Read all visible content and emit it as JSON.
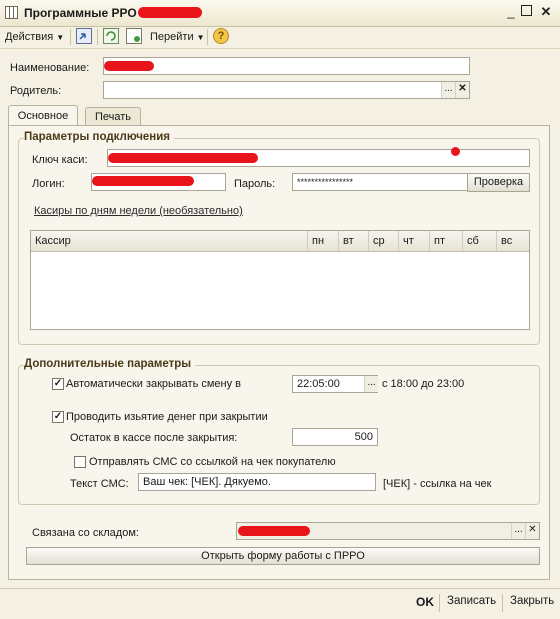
{
  "window": {
    "title": "Программные РРО"
  },
  "toolbar": {
    "actions_label": "Действия",
    "goto_label": "Перейти",
    "help_glyph": "?"
  },
  "form": {
    "name_label": "Наименование:",
    "parent_label": "Родитель:"
  },
  "tabs": [
    {
      "label": "Основное",
      "active": true
    },
    {
      "label": "Печать",
      "active": false
    }
  ],
  "connection": {
    "title": "Параметры подключения",
    "key_label": "Ключ каси:",
    "login_label": "Логин:",
    "password_label": "Пароль:",
    "password_value": "****************",
    "check_button": "Проверка",
    "cashiers_link": "Касиры по дням недели (необязательно)",
    "table_columns": [
      "Кассир",
      "пн",
      "вт",
      "ср",
      "чт",
      "пт",
      "сб",
      "вс"
    ]
  },
  "extra": {
    "title": "Дополнительные параметры",
    "auto_close_label": "Автоматически закрывать смену в",
    "auto_close_checked": true,
    "auto_close_time": "22:05:00",
    "auto_close_range": "с 18:00 до 23:00",
    "withdraw_label": "Проводить изьятие денег при закрытии",
    "withdraw_checked": true,
    "remainder_label": "Остаток в кассе после закрытия:",
    "remainder_value": "500",
    "sms_label": "Отправлять СМС со ссылкой на чек покупателю",
    "sms_checked": false,
    "sms_text_label": "Текст СМС:",
    "sms_text_value": "Ваш чек: [ЧЕК]. Дякуемо.",
    "sms_hint": "[ЧЕК] - ссылка на чек"
  },
  "warehouse": {
    "label": "Связана со складом:",
    "open_form_button": "Открыть форму работы с ПРРО"
  },
  "footer": {
    "ok": "OK",
    "save": "Записать",
    "close": "Закрыть"
  },
  "colors": {
    "redaction": "#e8141a",
    "group_title": "#4b3a18",
    "background": "#f4f1e4"
  }
}
